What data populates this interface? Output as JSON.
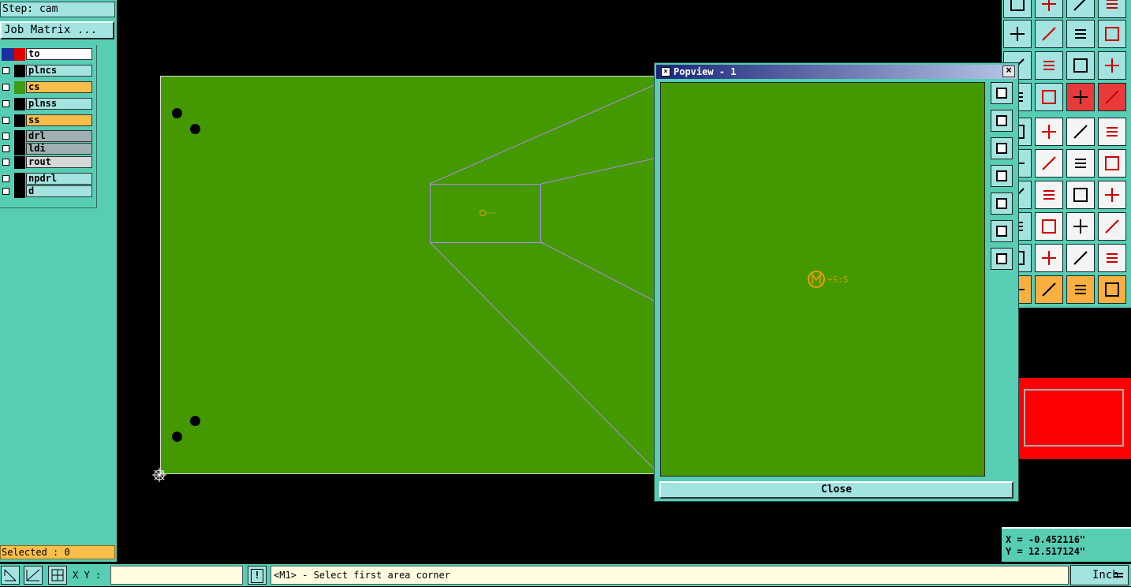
{
  "left_panel": {
    "step_label": "Step: cam",
    "job_matrix_label": "Job Matrix ...",
    "layers": [
      {
        "name": "to",
        "swatch": "#e00000",
        "fill": "#ffffff",
        "active": true
      },
      {
        "name": "plncs",
        "swatch": "#000000",
        "fill": "#a3e3e0"
      },
      {
        "name": "cs",
        "swatch": "#3d9b16",
        "fill": "#fbbe4a"
      },
      {
        "name": "plnss",
        "swatch": "#000000",
        "fill": "#a3e3e0"
      },
      {
        "name": "ss",
        "swatch": "#000000",
        "fill": "#fbbe4a"
      },
      {
        "name": "drl",
        "swatch": "#000000",
        "fill": "#a0b0b2"
      },
      {
        "name": "ldi",
        "swatch": "#000000",
        "fill": "#a0b0b2"
      },
      {
        "name": "rout",
        "swatch": "#000000",
        "fill": "#d4d8d8"
      },
      {
        "name": "npdrl",
        "swatch": "#000000",
        "fill": "#a3e3e0"
      },
      {
        "name": "d",
        "swatch": "#000000",
        "fill": "#a3e3e0"
      }
    ],
    "selected_text": "Selected : 0"
  },
  "bottom_bar": {
    "xy_label": "X Y :",
    "xy_value": "",
    "warning_glyph": "!",
    "message": "<M1> - Select first area corner",
    "unit": "Inch"
  },
  "coords": {
    "x_text": "X = -0.452116\"",
    "y_text": "Y = 12.517124\""
  },
  "popview": {
    "title": "Popview - 1",
    "close_label": "Close",
    "close_x": "×"
  },
  "colors": {
    "panel": "#57cdb4",
    "button": "#a3e3e0",
    "board": "#449900",
    "zoom_lines": "#b08ae6",
    "feature": "#e8a000"
  }
}
